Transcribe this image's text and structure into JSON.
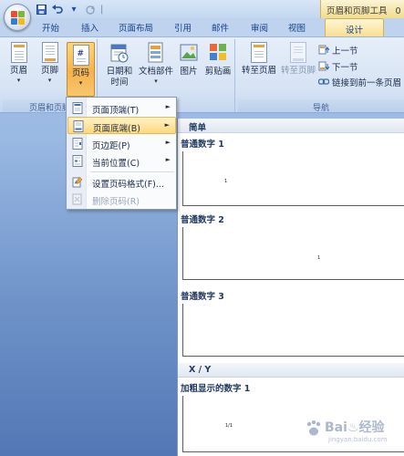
{
  "quick_access": {
    "save_icon": "save-icon",
    "undo_icon": "undo-icon",
    "redo_icon": "redo-icon",
    "separator": "|",
    "dropdown": "▾"
  },
  "window": {
    "context_title": "页眉和页脚工具",
    "title_tail": "0"
  },
  "tabs": [
    {
      "label": "开始"
    },
    {
      "label": "插入"
    },
    {
      "label": "页面布局"
    },
    {
      "label": "引用"
    },
    {
      "label": "邮件"
    },
    {
      "label": "审阅"
    },
    {
      "label": "视图"
    },
    {
      "label": "设计",
      "active": true
    }
  ],
  "ribbon": {
    "group_header_footer": {
      "label": "页眉和页脚",
      "buttons": [
        {
          "label": "页眉",
          "arrow": "▾"
        },
        {
          "label": "页脚",
          "arrow": "▾"
        },
        {
          "label": "页码",
          "arrow": "▾",
          "pressed": true
        }
      ]
    },
    "group_insert": {
      "buttons": [
        {
          "label_line1": "日期和",
          "label_line2": "时间"
        },
        {
          "label": "文档部件",
          "arrow": "▾"
        },
        {
          "label": "图片"
        },
        {
          "label": "剪贴画"
        }
      ]
    },
    "group_nav": {
      "label": "导航",
      "buttons": [
        {
          "label": "转至页眉"
        },
        {
          "label": "转至页脚",
          "disabled": true
        }
      ],
      "small_buttons": [
        {
          "label": "上一节"
        },
        {
          "label": "下一节"
        },
        {
          "label": "链接到前一条页眉"
        }
      ]
    }
  },
  "page_number_menu": {
    "items": [
      {
        "label": "页面顶端(T)",
        "arrow": "►",
        "icon": "page-top-icon"
      },
      {
        "label": "页面底端(B)",
        "arrow": "►",
        "icon": "page-bottom-icon",
        "highlighted": true
      },
      {
        "label": "页边距(P)",
        "arrow": "►",
        "icon": "page-margin-icon"
      },
      {
        "label": "当前位置(C)",
        "arrow": "►",
        "icon": "current-position-icon"
      },
      {
        "label": "设置页码格式(F)...",
        "icon": "format-page-number-icon"
      },
      {
        "label": "删除页码(R)",
        "icon": "remove-page-number-icon",
        "disabled": true
      }
    ]
  },
  "gallery": {
    "section_simple": "简单",
    "items": [
      {
        "title": "普通数字 1",
        "number": "1"
      },
      {
        "title": "普通数字 2",
        "number": "1"
      },
      {
        "title": "普通数字 3",
        "number": ""
      }
    ],
    "section_xy": "X / Y",
    "bold_item": {
      "title": "加粗显示的数字 1",
      "number": "1/1"
    }
  },
  "watermark": {
    "text": "Bai♨经验",
    "sub": "jingyan.baidu.com"
  },
  "colors": {
    "accent_orange": "#f6b34c",
    "ribbon_blue": "#d6e3f4",
    "tab_text": "#15428b",
    "context_gold": "#f2dc8c"
  }
}
